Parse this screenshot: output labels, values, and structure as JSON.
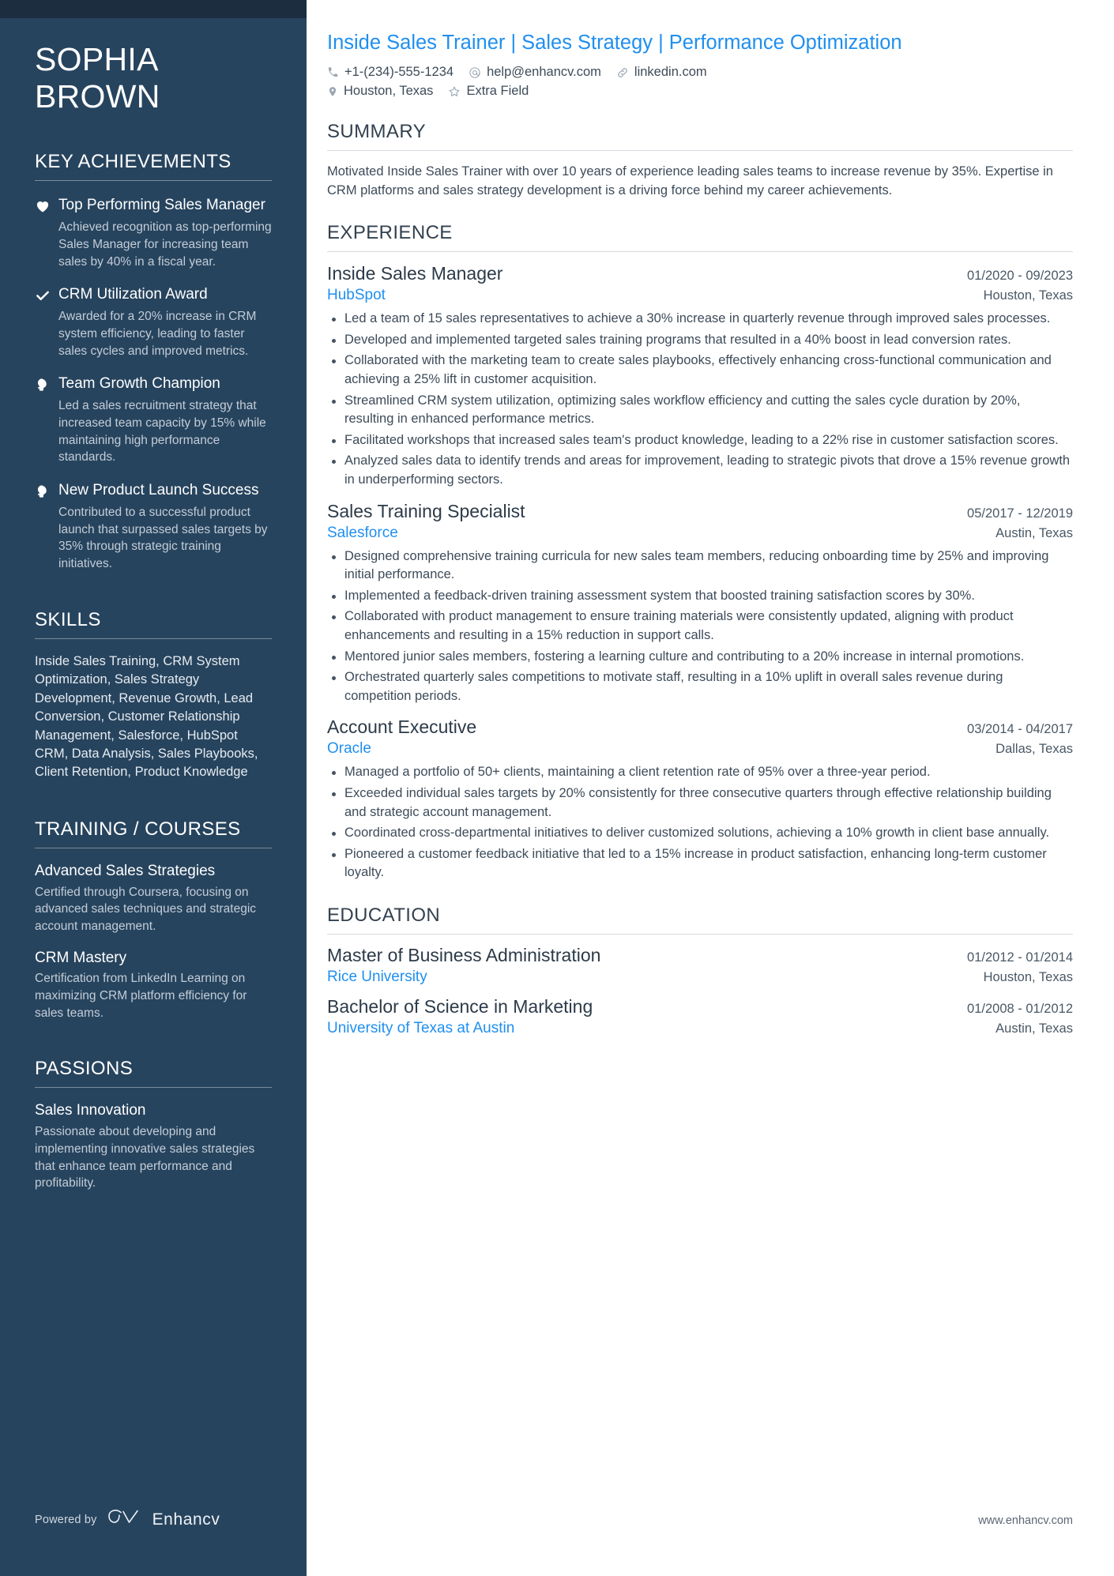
{
  "colors": {
    "sidebar_bg": "#27445e",
    "topbar_bg": "#1b2d3f",
    "accent_blue": "#1f8fef",
    "body_text": "#3d4b59"
  },
  "sidebar": {
    "name_line1": "SOPHIA",
    "name_line2": "BROWN",
    "achievements_heading": "KEY ACHIEVEMENTS",
    "achievements": [
      {
        "icon": "heart-icon",
        "title": "Top Performing Sales Manager",
        "desc": "Achieved recognition as top-performing Sales Manager for increasing team sales by 40% in a fiscal year."
      },
      {
        "icon": "check-icon",
        "title": "CRM Utilization Award",
        "desc": "Awarded for a 20% increase in CRM system efficiency, leading to faster sales cycles and improved metrics."
      },
      {
        "icon": "head-profile-icon",
        "title": "Team Growth Champion",
        "desc": "Led a sales recruitment strategy that increased team capacity by 15% while maintaining high performance standards."
      },
      {
        "icon": "head-profile-icon",
        "title": "New Product Launch Success",
        "desc": "Contributed to a successful product launch that surpassed sales targets by 35% through strategic training initiatives."
      }
    ],
    "skills_heading": "SKILLS",
    "skills_text": "Inside Sales Training, CRM System Optimization, Sales Strategy Development, Revenue Growth, Lead Conversion, Customer Relationship Management, Salesforce, HubSpot CRM, Data Analysis, Sales Playbooks, Client Retention, Product Knowledge",
    "training_heading": "TRAINING / COURSES",
    "courses": [
      {
        "title": "Advanced Sales Strategies",
        "desc": "Certified through Coursera, focusing on advanced sales techniques and strategic account management."
      },
      {
        "title": "CRM Mastery",
        "desc": "Certification from LinkedIn Learning on maximizing CRM platform efficiency for sales teams."
      }
    ],
    "passions_heading": "PASSIONS",
    "passions": [
      {
        "title": "Sales Innovation",
        "desc": "Passionate about developing and implementing innovative sales strategies that enhance team performance and profitability."
      }
    ],
    "footer": {
      "powered_by": "Powered by",
      "brand": "Enhancv"
    }
  },
  "main": {
    "headline": "Inside Sales Trainer | Sales Strategy | Performance Optimization",
    "contacts": [
      {
        "icon": "phone-icon",
        "text": "+1-(234)-555-1234"
      },
      {
        "icon": "email-icon",
        "text": "help@enhancv.com"
      },
      {
        "icon": "link-icon",
        "text": "linkedin.com"
      }
    ],
    "contacts_row2": [
      {
        "icon": "location-pin-icon",
        "text": "Houston, Texas"
      },
      {
        "icon": "star-icon",
        "text": "Extra Field"
      }
    ],
    "summary_heading": "SUMMARY",
    "summary_text": "Motivated Inside Sales Trainer with over 10 years of experience leading sales teams to increase revenue by 35%. Expertise in CRM platforms and sales strategy development is a driving force behind my career achievements.",
    "experience_heading": "EXPERIENCE",
    "jobs": [
      {
        "title": "Inside Sales Manager",
        "dates": "01/2020 - 09/2023",
        "company": "HubSpot",
        "location": "Houston, Texas",
        "bullets": [
          "Led a team of 15 sales representatives to achieve a 30% increase in quarterly revenue through improved sales processes.",
          "Developed and implemented targeted sales training programs that resulted in a 40% boost in lead conversion rates.",
          "Collaborated with the marketing team to create sales playbooks, effectively enhancing cross-functional communication and achieving a 25% lift in customer acquisition.",
          "Streamlined CRM system utilization, optimizing sales workflow efficiency and cutting the sales cycle duration by 20%, resulting in enhanced performance metrics.",
          "Facilitated workshops that increased sales team's product knowledge, leading to a 22% rise in customer satisfaction scores.",
          "Analyzed sales data to identify trends and areas for improvement, leading to strategic pivots that drove a 15% revenue growth in underperforming sectors."
        ]
      },
      {
        "title": "Sales Training Specialist",
        "dates": "05/2017 - 12/2019",
        "company": "Salesforce",
        "location": "Austin, Texas",
        "bullets": [
          "Designed comprehensive training curricula for new sales team members, reducing onboarding time by 25% and improving initial performance.",
          "Implemented a feedback-driven training assessment system that boosted training satisfaction scores by 30%.",
          "Collaborated with product management to ensure training materials were consistently updated, aligning with product enhancements and resulting in a 15% reduction in support calls.",
          "Mentored junior sales members, fostering a learning culture and contributing to a 20% increase in internal promotions.",
          "Orchestrated quarterly sales competitions to motivate staff, resulting in a 10% uplift in overall sales revenue during competition periods."
        ]
      },
      {
        "title": "Account Executive",
        "dates": "03/2014 - 04/2017",
        "company": "Oracle",
        "location": "Dallas, Texas",
        "bullets": [
          "Managed a portfolio of 50+ clients, maintaining a client retention rate of 95% over a three-year period.",
          "Exceeded individual sales targets by 20% consistently for three consecutive quarters through effective relationship building and strategic account management.",
          "Coordinated cross-departmental initiatives to deliver customized solutions, achieving a 10% growth in client base annually.",
          "Pioneered a customer feedback initiative that led to a 15% increase in product satisfaction, enhancing long-term customer loyalty."
        ]
      }
    ],
    "education_heading": "EDUCATION",
    "education": [
      {
        "degree": "Master of Business Administration",
        "dates": "01/2012 - 01/2014",
        "school": "Rice University",
        "location": "Houston, Texas"
      },
      {
        "degree": "Bachelor of Science in Marketing",
        "dates": "01/2008 - 01/2012",
        "school": "University of Texas at Austin",
        "location": "Austin, Texas"
      }
    ],
    "footer_url": "www.enhancv.com"
  }
}
